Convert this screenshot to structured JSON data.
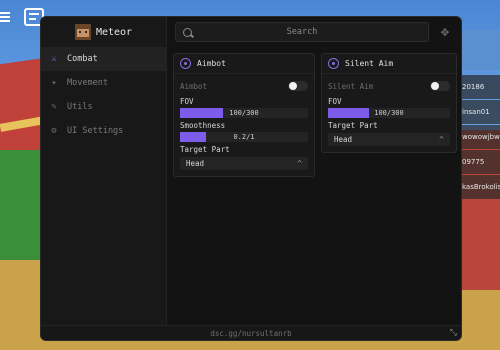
{
  "app": {
    "name": "Meteor"
  },
  "sidebar": {
    "items": [
      {
        "label": "Combat",
        "icon": "sword-icon",
        "active": true
      },
      {
        "label": "Movement",
        "icon": "running-icon",
        "active": false
      },
      {
        "label": "Utils",
        "icon": "wrench-icon",
        "active": false
      },
      {
        "label": "UI Settings",
        "icon": "gear-icon",
        "active": false
      }
    ]
  },
  "search": {
    "placeholder": "Search"
  },
  "panels": {
    "aimbot": {
      "title": "Aimbot",
      "toggle_label": "Aimbot",
      "toggle_on": false,
      "fov_label": "FOV",
      "fov_value": "100/300",
      "fov_fraction": 0.333,
      "smooth_label": "Smoothness",
      "smooth_value": "0.2/1",
      "smooth_fraction": 0.2,
      "target_label": "Target Part",
      "target_value": "Head"
    },
    "silent": {
      "title": "Silent Aim",
      "toggle_label": "Silent Aim",
      "toggle_on": false,
      "fov_label": "FOV",
      "fov_value": "100/300",
      "fov_fraction": 0.333,
      "target_label": "Target Part",
      "target_value": "Head"
    }
  },
  "footer": {
    "text": "dsc.gg/nursultanrb"
  },
  "players": [
    "20186",
    "insan01",
    "wowowjbw",
    "09775",
    "kasBrokolis"
  ],
  "colors": {
    "accent": "#7c5ce8",
    "window_bg": "#131313"
  }
}
